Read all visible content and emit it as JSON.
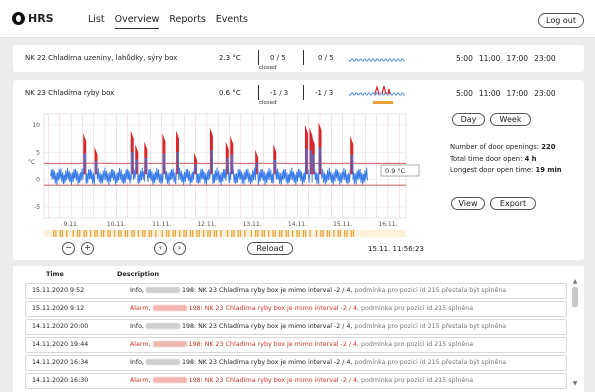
{
  "app": {
    "logo_text": "HRS"
  },
  "nav": {
    "items": [
      "List",
      "Overview",
      "Reports",
      "Events"
    ],
    "active": "Overview"
  },
  "logout_label": "Log out",
  "sensors": [
    {
      "name": "NK 22 Chladírna uzeniny, lahůdky, sýry box",
      "temp": "2.3 °C",
      "status": "closed",
      "range1": "0 / 5",
      "range2": "0 / 5",
      "times": [
        "5:00",
        "11:00",
        "17:00",
        "23:00"
      ]
    },
    {
      "name": "NK 23 Chladírna ryby box",
      "temp": "0.6 °C",
      "status": "closed",
      "range1": "-1 / 3",
      "range2": "-1 / 3",
      "times": [
        "5:00",
        "11:00",
        "17:00",
        "23:00"
      ]
    }
  ],
  "chart_data": {
    "type": "line",
    "ylabel": "°C",
    "ylim": [
      -7,
      12
    ],
    "yticks": [
      10,
      5,
      0,
      -5
    ],
    "x_tick_labels": [
      "9.11.",
      "10.11.",
      "11.11.",
      "12.11.",
      "13.11.",
      "14.11.",
      "15.11.",
      "16.11."
    ],
    "limits": [
      3,
      -1
    ],
    "current_value_label": "0.9 °C",
    "series": [
      {
        "type": "temperature",
        "color": "#3a7bea",
        "baseline": 0.6
      },
      {
        "type": "door-open",
        "color": "#d9252b",
        "spikes": [
          [
            9.3,
            8.5
          ],
          [
            9.55,
            6
          ],
          [
            10.35,
            9
          ],
          [
            10.45,
            6.5
          ],
          [
            10.65,
            7
          ],
          [
            11.05,
            8.5
          ],
          [
            11.35,
            9
          ],
          [
            11.75,
            5
          ],
          [
            12.1,
            9.5
          ],
          [
            12.45,
            7
          ],
          [
            12.55,
            8
          ],
          [
            13.1,
            5.5
          ],
          [
            13.5,
            6.5
          ],
          [
            14.2,
            10
          ],
          [
            14.3,
            9.5
          ],
          [
            14.35,
            8
          ],
          [
            14.5,
            10.5
          ],
          [
            15.2,
            8
          ]
        ]
      }
    ],
    "gridlines": true
  },
  "period": {
    "day": "Day",
    "week": "Week"
  },
  "stats": {
    "openings_label": "Number of door openings:",
    "openings_value": "220",
    "total_label": "Total time door open:",
    "total_value": "4 h",
    "longest_label": "Longest door open time:",
    "longest_value": "19 min"
  },
  "actions": {
    "view": "View",
    "export": "Export"
  },
  "controls": {
    "zoom_out": "−",
    "zoom_in": "+",
    "prev": "‹",
    "next": "›",
    "reload": "Reload",
    "timestamp": "15.11. 11:56:23"
  },
  "log": {
    "headers": {
      "time": "Time",
      "description": "Description"
    },
    "rows": [
      {
        "time": "15.11.2020 9:52",
        "type": "Info",
        "main": "198: NK 23 Chladírna ryby box je mimo interval -2 / 4,",
        "rest": "podmínka pro pozici id 215 přestala být splněna"
      },
      {
        "time": "15.11.2020 9:12",
        "type": "Alarm",
        "main": "198: NK 23 Chladírna ryby box je mimo interval -2 / 4,",
        "rest": "podmínka pro pozici id 215 splněna"
      },
      {
        "time": "14.11.2020 20:00",
        "type": "Info",
        "main": "198: NK 23 Chladírna ryby box je mimo interval -2 / 4,",
        "rest": "podmínka pro pozici id 215 přestala být splněna"
      },
      {
        "time": "14.11.2020 19:44",
        "type": "Alarm",
        "main": "198: NK 23 Chladírna ryby box je mimo interval -2 / 4,",
        "rest": "podmínka pro pozici id 215 splněna"
      },
      {
        "time": "14.11.2020 16:34",
        "type": "Info",
        "main": "198: NK 23 Chladírna ryby box je mimo interval -2 / 4,",
        "rest": "podmínka pro pozici id 215 přestala být splněna"
      },
      {
        "time": "14.11.2020 16:30",
        "type": "Alarm",
        "main": "198: NK 23 Chladírna ryby box je mimo interval -2 / 4,",
        "rest": "podmínka pro pozici id 215 splněna"
      }
    ]
  }
}
